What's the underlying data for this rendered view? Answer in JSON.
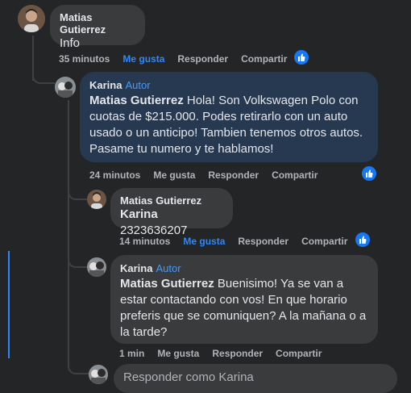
{
  "comments": [
    {
      "author": "Matias Gutierrez",
      "badge": "",
      "text": "Info",
      "time": "35 minutos",
      "like_label": "Me gusta",
      "reply_label": "Responder",
      "share_label": "Compartir",
      "liked": true
    },
    {
      "author": "Karina",
      "badge": "Autor",
      "mention": "Matias Gutierrez",
      "text": " Hola! Son Volkswagen Polo con cuotas de $215.000. Podes retirarlo con un auto usado o un anticipo! Tambien tenemos otros autos. Pasame tu numero y te hablamos!",
      "time": "24 minutos",
      "like_label": "Me gusta",
      "reply_label": "Responder",
      "share_label": "Compartir",
      "liked": false
    },
    {
      "author": "Matias Gutierrez",
      "badge": "",
      "mention": "Karina",
      "text": " 2323636207",
      "time": "14 minutos",
      "like_label": "Me gusta",
      "reply_label": "Responder",
      "share_label": "Compartir",
      "liked": true
    },
    {
      "author": "Karina",
      "badge": "Autor",
      "mention": "Matias Gutierrez",
      "text": " Buenisimo! Ya se van a estar contactando con vos! En que horario preferis que se comuniquen? A la mañana o a la tarde?",
      "time": "1 min",
      "like_label": "Me gusta",
      "reply_label": "Responder",
      "share_label": "Compartir",
      "liked": false
    }
  ],
  "reply_box": {
    "placeholder": "Responder como Karina"
  },
  "colors": {
    "background": "#242526",
    "bubble": "#3a3b3c",
    "highlight_bubble": "#263951",
    "accent": "#2d88ff",
    "muted": "#b0b3b8"
  }
}
